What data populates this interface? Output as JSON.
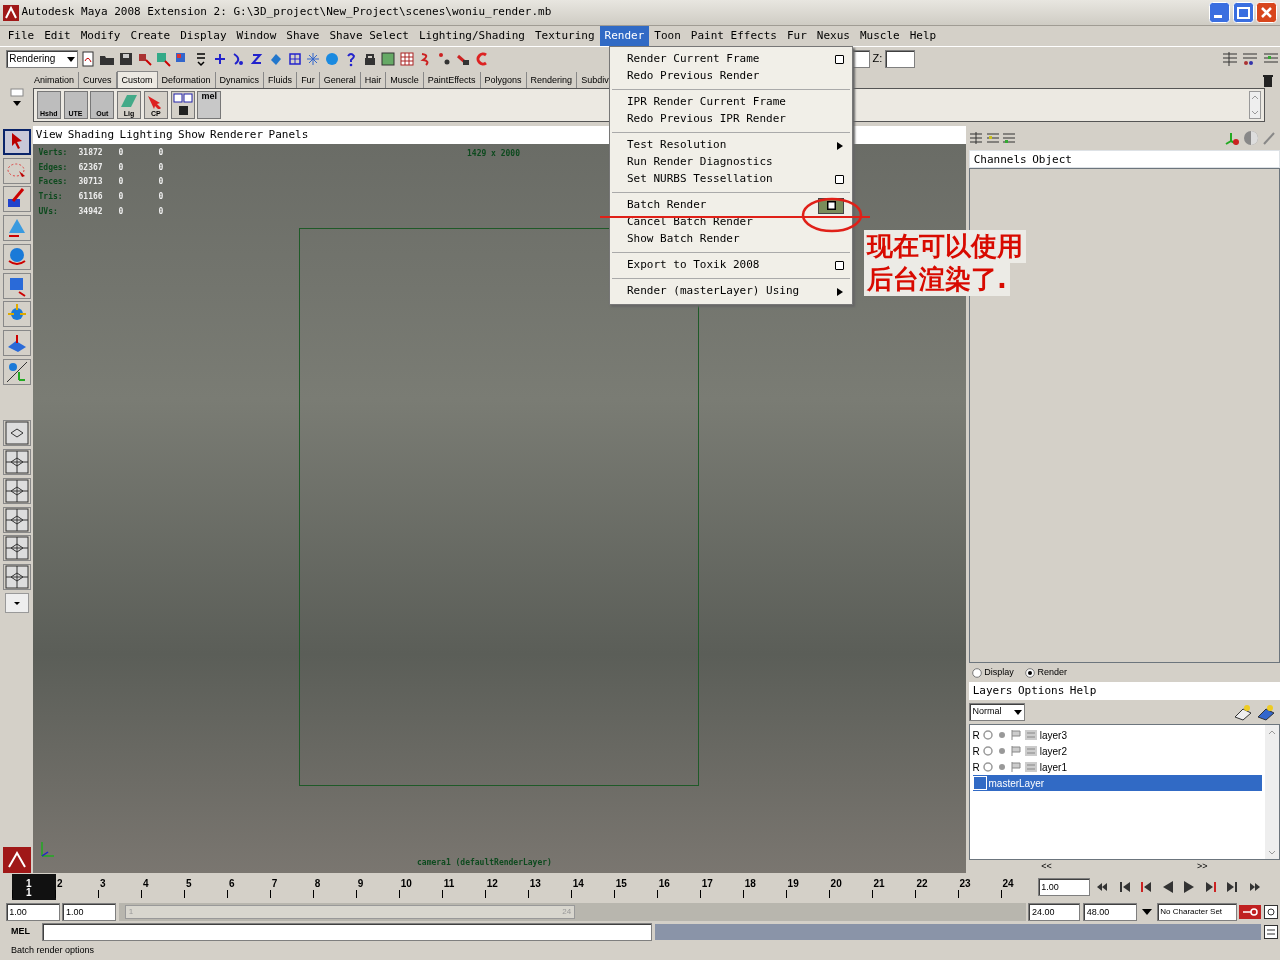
{
  "window": {
    "title": "Autodesk Maya 2008 Extension 2: G:\\3D_project\\New_Project\\scenes\\woniu_render.mb"
  },
  "menubar": [
    {
      "label": "File",
      "selected": false
    },
    {
      "label": "Edit",
      "selected": false
    },
    {
      "label": "Modify",
      "selected": false
    },
    {
      "label": "Create",
      "selected": false
    },
    {
      "label": "Display",
      "selected": false
    },
    {
      "label": "Window",
      "selected": false
    },
    {
      "label": "Shave",
      "selected": false
    },
    {
      "label": "Shave Select",
      "selected": false
    },
    {
      "label": "Lighting/Shading",
      "selected": false
    },
    {
      "label": "Texturing",
      "selected": false
    },
    {
      "label": "Render",
      "selected": true
    },
    {
      "label": "Toon",
      "selected": false
    },
    {
      "label": "Paint Effects",
      "selected": false
    },
    {
      "label": "Fur",
      "selected": false
    },
    {
      "label": "Nexus",
      "selected": false
    },
    {
      "label": "Muscle",
      "selected": false
    },
    {
      "label": "Help",
      "selected": false
    }
  ],
  "status_line": {
    "menu_set": "Rendering",
    "field_labels": [
      "Z:"
    ]
  },
  "shelf_tabs": [
    {
      "label": "Animation",
      "selected": false
    },
    {
      "label": "Curves",
      "selected": false
    },
    {
      "label": "Custom",
      "selected": true
    },
    {
      "label": "Deformation",
      "selected": false
    },
    {
      "label": "Dynamics",
      "selected": false
    },
    {
      "label": "Fluids",
      "selected": false
    },
    {
      "label": "Fur",
      "selected": false
    },
    {
      "label": "General",
      "selected": false
    },
    {
      "label": "Hair",
      "selected": false
    },
    {
      "label": "Muscle",
      "selected": false
    },
    {
      "label": "PaintEffects",
      "selected": false
    },
    {
      "label": "Polygons",
      "selected": false
    },
    {
      "label": "Rendering",
      "selected": false
    },
    {
      "label": "Subdiv",
      "selected": false
    }
  ],
  "shelf_buttons": [
    {
      "kind": "text",
      "label": "Hshd"
    },
    {
      "kind": "text",
      "label": "UTE"
    },
    {
      "kind": "text",
      "label": "Out"
    },
    {
      "kind": "icon",
      "label": "Lig"
    },
    {
      "kind": "icon",
      "label": "CP"
    },
    {
      "kind": "icon"
    },
    {
      "kind": "mel",
      "label": "mel"
    }
  ],
  "toolbox": [
    {
      "selected": true
    },
    {
      "selected": false
    },
    {
      "selected": false
    },
    {
      "selected": false
    },
    {
      "selected": false
    },
    {
      "selected": false
    },
    {
      "selected": false
    },
    {
      "selected": false
    },
    {
      "selected": false
    }
  ],
  "panel_menu": [
    "View",
    "Shading",
    "Lighting",
    "Show",
    "Renderer",
    "Panels"
  ],
  "hud": [
    {
      "label": "Verts:",
      "values": [
        "31872",
        "0",
        "0"
      ]
    },
    {
      "label": "Edges:",
      "values": [
        "62367",
        "0",
        "0"
      ]
    },
    {
      "label": "Faces:",
      "values": [
        "30713",
        "0",
        "0"
      ]
    },
    {
      "label": "Tris:",
      "values": [
        "61166",
        "0",
        "0"
      ]
    },
    {
      "label": "UVs:",
      "values": [
        "34942",
        "0",
        "0"
      ]
    }
  ],
  "resolution": "1429 x 2000",
  "camera_label": "camera1 (defaultRenderLayer)",
  "render_menu": [
    {
      "kind": "item",
      "label": "Render Current Frame",
      "option_box": true,
      "option_hover": false,
      "submenu": false
    },
    {
      "kind": "item",
      "label": "Redo Previous Render",
      "option_box": false,
      "submenu": false
    },
    {
      "kind": "divider"
    },
    {
      "kind": "item",
      "label": "IPR Render Current Frame",
      "option_box": false,
      "submenu": false
    },
    {
      "kind": "item",
      "label": "Redo Previous IPR Render",
      "option_box": false,
      "submenu": false
    },
    {
      "kind": "divider"
    },
    {
      "kind": "item",
      "label": "Test Resolution",
      "option_box": false,
      "submenu": true
    },
    {
      "kind": "item",
      "label": "Run Render Diagnostics",
      "option_box": false,
      "submenu": false
    },
    {
      "kind": "item",
      "label": "Set NURBS Tessellation",
      "option_box": true,
      "option_hover": false,
      "submenu": false
    },
    {
      "kind": "divider"
    },
    {
      "kind": "item",
      "label": "Batch Render",
      "option_box": true,
      "option_hover": true,
      "submenu": false
    },
    {
      "kind": "item",
      "label": "Cancel Batch Render",
      "option_box": false,
      "submenu": false
    },
    {
      "kind": "item",
      "label": "Show Batch Render",
      "option_box": false,
      "submenu": false
    },
    {
      "kind": "divider"
    },
    {
      "kind": "item",
      "label": "Export to Toxik 2008",
      "option_box": true,
      "option_hover": false,
      "submenu": false
    },
    {
      "kind": "divider"
    },
    {
      "kind": "item",
      "label": "Render (masterLayer) Using",
      "option_box": false,
      "submenu": true
    }
  ],
  "annotation": [
    "现在可以使用",
    "后台渲染了."
  ],
  "channel_box": {
    "menu": [
      "Channels",
      "Object"
    ]
  },
  "layer_editor": {
    "modes": [
      {
        "label": "Display",
        "selected": false
      },
      {
        "label": "Render",
        "selected": true
      }
    ],
    "menu": [
      "Layers",
      "Options",
      "Help"
    ],
    "blend_mode": "Normal",
    "layers": [
      {
        "kind": "layer",
        "flag": "R",
        "name": "layer3",
        "selected": false
      },
      {
        "kind": "layer",
        "flag": "R",
        "name": "layer2",
        "selected": false
      },
      {
        "kind": "layer",
        "flag": "R",
        "name": "layer1",
        "selected": false
      },
      {
        "kind": "master",
        "name": "masterLayer",
        "selected": true
      }
    ],
    "scroll_left": "<<",
    "scroll_right": ">>"
  },
  "timeline": {
    "ticks": [
      "1",
      "2",
      "3",
      "4",
      "5",
      "6",
      "7",
      "8",
      "9",
      "10",
      "11",
      "12",
      "13",
      "14",
      "15",
      "16",
      "17",
      "18",
      "19",
      "20",
      "21",
      "22",
      "23",
      "24"
    ],
    "current_frame": "1",
    "level": 0,
    "current_time": "1.00"
  },
  "range": {
    "level": 0.5,
    "start": "1.00",
    "playback_start": "1.00",
    "slider_start": "1",
    "slider_end": "24",
    "playback_end": "24.00",
    "end": "48.00",
    "character_set": "No Character Set"
  },
  "command_line": {
    "label": "MEL"
  },
  "help_line": "Batch render options"
}
